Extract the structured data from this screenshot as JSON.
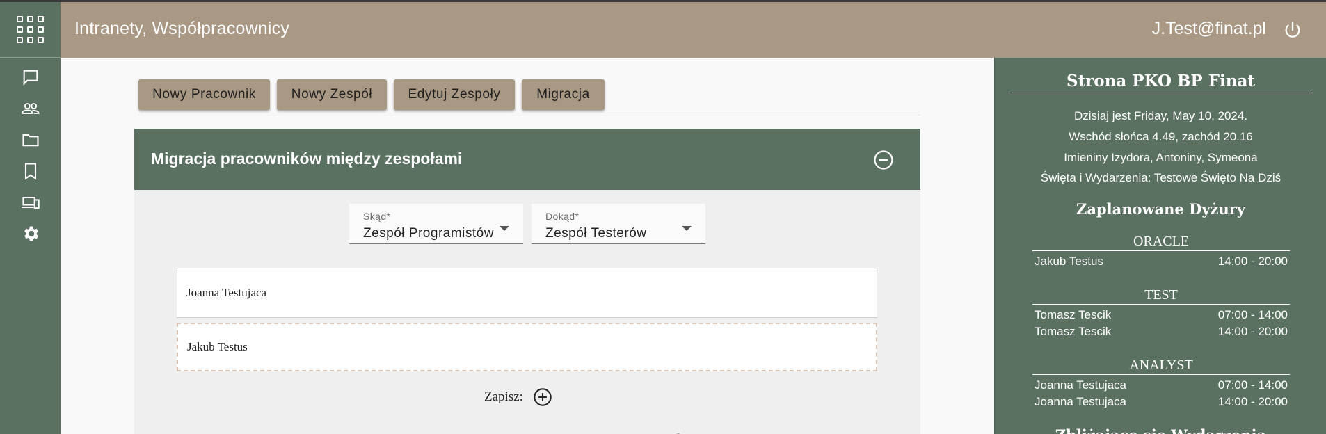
{
  "header": {
    "title": "Intranety, Współpracownicy",
    "user_email": "J.Test@finat.pl"
  },
  "rail": {
    "items": [
      {
        "icon": "chat-icon"
      },
      {
        "icon": "people-icon"
      },
      {
        "icon": "folder-icon"
      },
      {
        "icon": "bookmark-icon"
      },
      {
        "icon": "devices-icon"
      },
      {
        "icon": "gear-icon"
      }
    ]
  },
  "toolbar": {
    "buttons": [
      {
        "label": "Nowy Pracownik"
      },
      {
        "label": "Nowy Zespół"
      },
      {
        "label": "Edytuj Zespoły"
      },
      {
        "label": "Migracja"
      }
    ]
  },
  "panel": {
    "title": "Migracja pracowników między zespołami",
    "from": {
      "label": "Skąd*",
      "value": "Zespół Programistów"
    },
    "to": {
      "label": "Dokąd*",
      "value": "Zespół Testerów"
    },
    "employees": [
      "Joanna Testujaca",
      "Jakub Testus"
    ],
    "save_label": "Zapisz:"
  },
  "sidebar": {
    "title": "Strona PKO BP Finat",
    "info": [
      "Dzisiaj jest Friday, May 10, 2024.",
      "Wschód słońca 4.49, zachód 20.16",
      "Imieniny Izydora, Antoniny, Symeona",
      "Święta i Wydarzenia: Testowe Święto Na Dziś"
    ],
    "duty_title": "Zaplanowane Dyżury",
    "groups": [
      {
        "name": "ORACLE",
        "rows": [
          {
            "person": "Jakub Testus",
            "time": "14:00 - 20:00"
          }
        ]
      },
      {
        "name": "TEST",
        "rows": [
          {
            "person": "Tomasz Tescik",
            "time": "07:00 - 14:00"
          },
          {
            "person": "Tomasz Tescik",
            "time": "14:00 - 20:00"
          }
        ]
      },
      {
        "name": "ANALYST",
        "rows": [
          {
            "person": "Joanna Testujaca",
            "time": "07:00 - 14:00"
          },
          {
            "person": "Joanna Testujaca",
            "time": "14:00 - 20:00"
          }
        ]
      }
    ],
    "next_section_partial": "Zbliżające się Wydarzenia"
  },
  "colors": {
    "header_bg": "#a89884",
    "rail_bg": "#5a7060",
    "panel_bg": "#efefef"
  }
}
